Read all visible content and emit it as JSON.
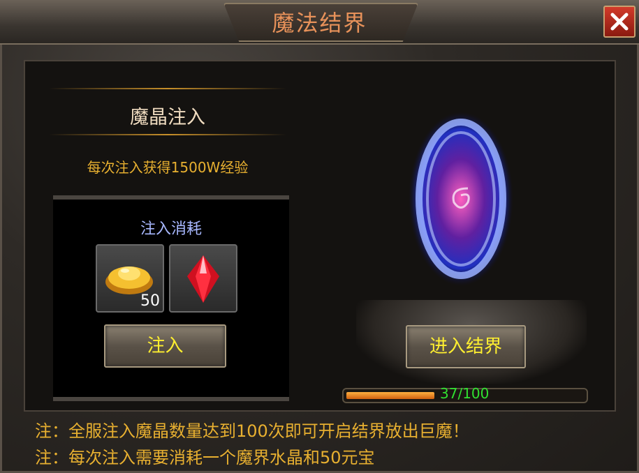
{
  "window": {
    "title": "魔法结界",
    "close_icon": "close-icon"
  },
  "inject_panel": {
    "section_title": "魔晶注入",
    "description": "每次注入获得1500W经验",
    "cost_label": "注入消耗",
    "items": [
      {
        "icon": "gold-ingot-icon",
        "count": "50"
      },
      {
        "icon": "red-crystal-icon",
        "count": ""
      }
    ],
    "inject_button": "注入"
  },
  "portal_panel": {
    "enter_button": "进入结界",
    "progress_text": "37/100",
    "progress_value": 37,
    "progress_max": 100
  },
  "notes": [
    "注：全服注入魔晶数量达到100次即可开启结界放出巨魔！",
    "注：每次注入需要消耗一个魔界水晶和50元宝"
  ],
  "colors": {
    "title": "#e8925a",
    "gold_text": "#e8b030",
    "button_text": "#ffef30",
    "progress_text": "#30e030",
    "cost_label": "#a8b8ff"
  }
}
